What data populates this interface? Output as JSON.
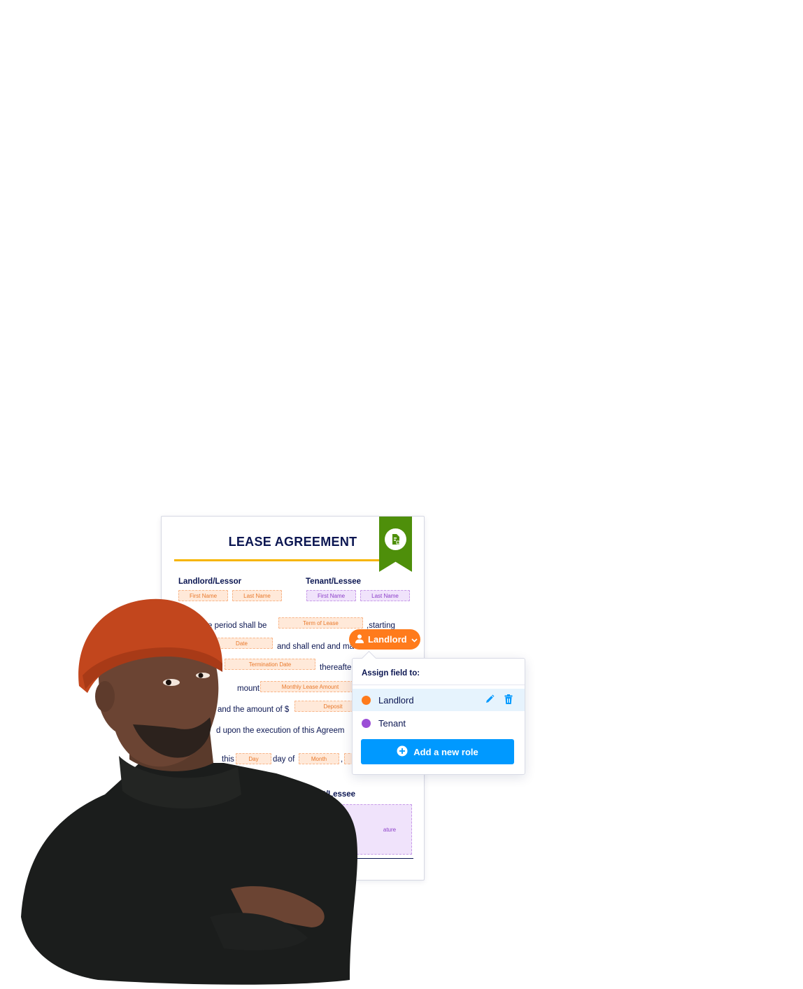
{
  "document": {
    "title": "LEASE AGREEMENT",
    "badge_icon": "document-lock-icon",
    "landlord_label": "Landlord/Lessor",
    "tenant_label": "Tenant/Lessee",
    "landlord_fields": [
      "First Name",
      "Last Name"
    ],
    "tenant_fields": [
      "First Name",
      "Last Name"
    ],
    "lines": {
      "l1": "e period shall be",
      "l1_field": "Term of Lease",
      "l1_after": ",starting",
      "l2_field": "Date",
      "l2_after": "and shall end and ma",
      "l3_field": "Termination Date",
      "l3_after": "thereafte",
      "l4": "mount of $",
      "l4_field": "Monthly Lease Amount",
      "l5": "and the amount of $",
      "l5_field": "Deposit",
      "l6": "d upon the execution of this Agreem",
      "l7": "this",
      "l7_day": "Day",
      "l7_mid": "day of",
      "l7_month": "Month",
      "l7_comma": ","
    },
    "bottom_label": "nt/Lessee",
    "signature_text": "ature"
  },
  "pill": {
    "label": "Landlord",
    "icon": "user-icon",
    "chevron": "chevron-down-icon"
  },
  "popup": {
    "title": "Assign field to:",
    "roles": [
      {
        "name": "Landlord",
        "color": "#ff7b1c"
      },
      {
        "name": "Tenant",
        "color": "#9b4ed6"
      }
    ],
    "edit_icon": "pencil-icon",
    "delete_icon": "trash-icon",
    "add_button": "Add a new role",
    "add_icon": "plus-circle-icon"
  },
  "colors": {
    "accent_orange": "#ff7b1c",
    "accent_blue": "#0099ff",
    "ribbon_green": "#4e8f0a",
    "title_underline": "#f7b500",
    "navy_text": "#0a1551"
  }
}
